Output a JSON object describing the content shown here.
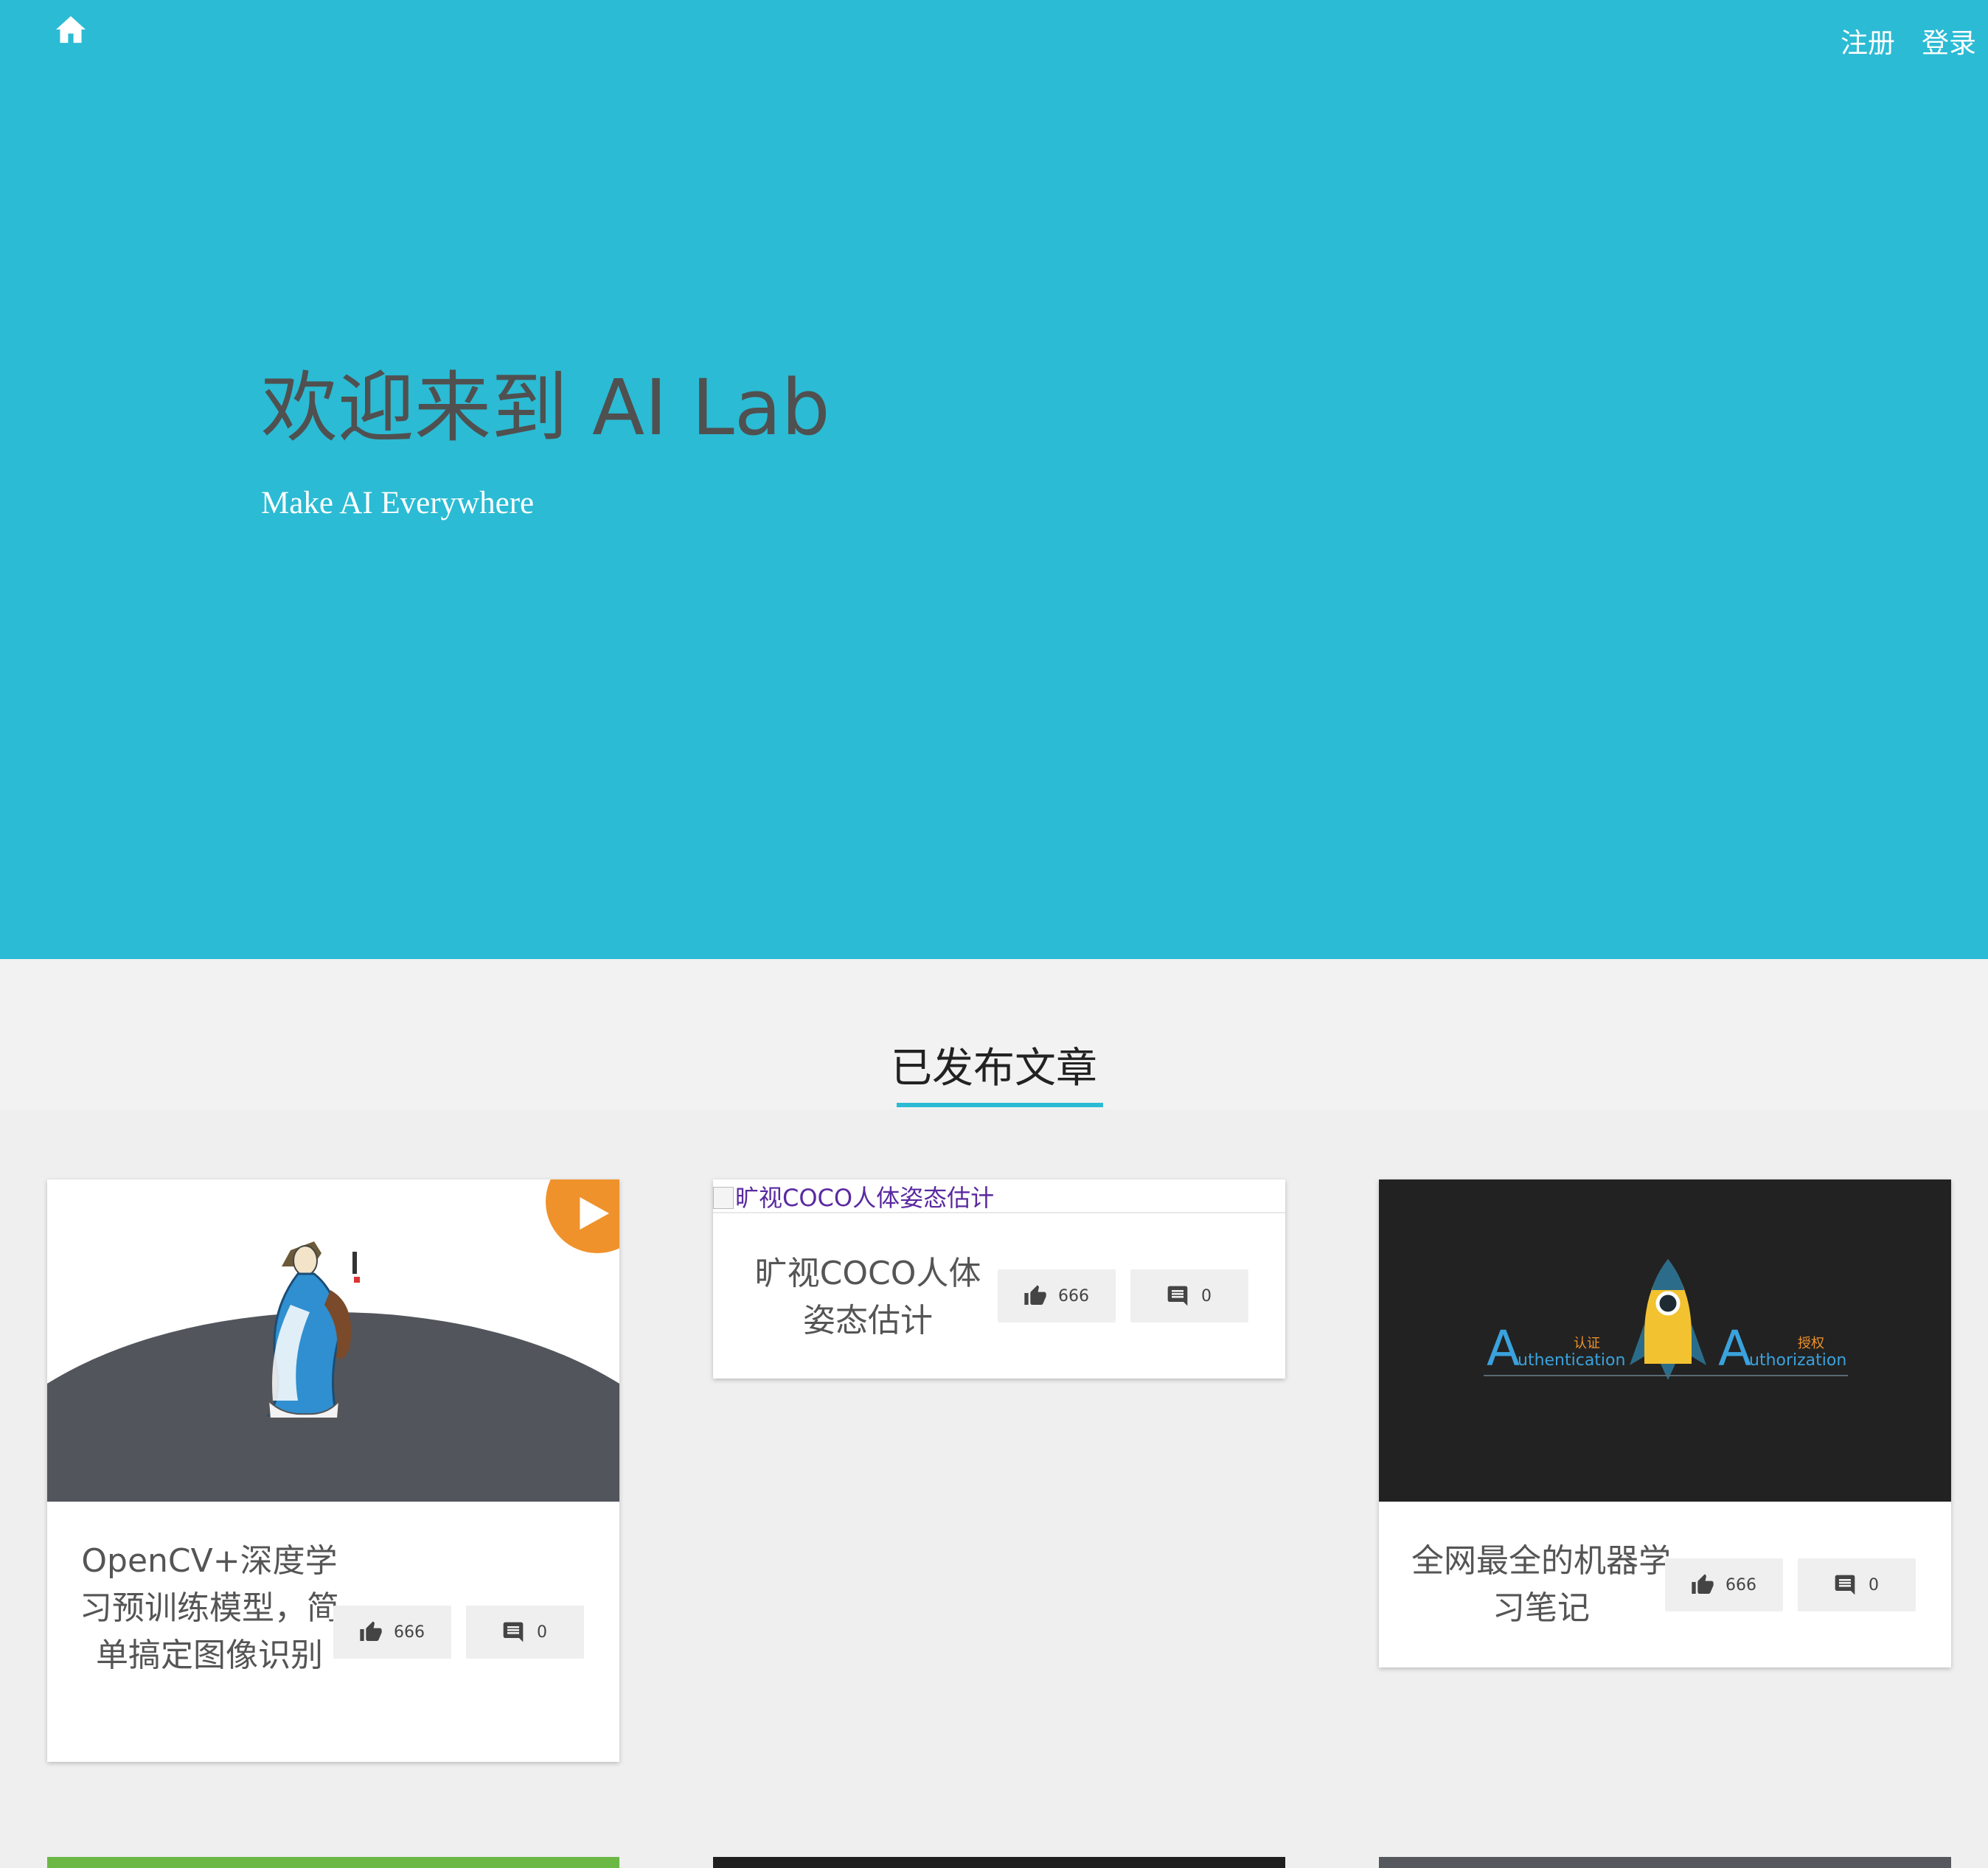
{
  "nav": {
    "home_icon": "home-icon",
    "register": "注册",
    "login": "登录"
  },
  "hero": {
    "title": "欢迎来到 AI Lab",
    "subtitle": "Make AI Everywhere"
  },
  "section": {
    "title": "已发布文章"
  },
  "articles": [
    {
      "title": "OpenCV+深度学习预训练模型，简单搞定图像识别",
      "likes": "666",
      "comments": "0",
      "has_video_badge": true
    },
    {
      "title": "旷视COCO人体姿态估计",
      "image_alt": "旷视COCO人体姿态估计",
      "likes": "666",
      "comments": "0"
    },
    {
      "title": "全网最全的机器学习笔记",
      "likes": "666",
      "comments": "0",
      "image_text": {
        "auth_big": "A",
        "auth_rest": "uthentication",
        "auth_cn": "认证",
        "authz_big": "A",
        "authz_rest": "uthorization",
        "authz_cn": "授权"
      }
    }
  ],
  "colors": {
    "primary": "#2bbbd4",
    "page_bg": "#efefef",
    "title_text": "#505050",
    "badge": "#f0922b"
  }
}
